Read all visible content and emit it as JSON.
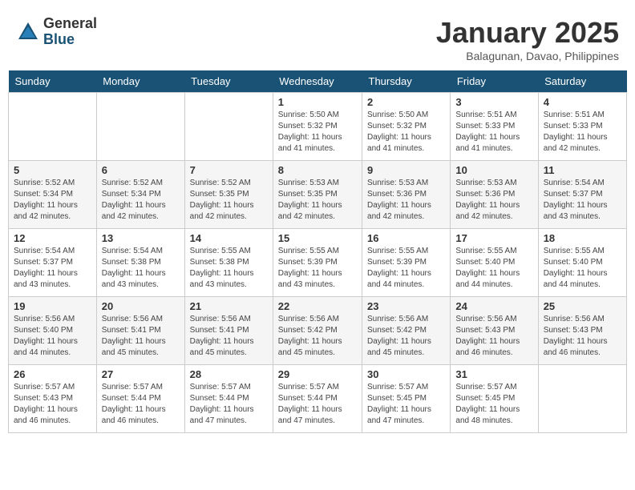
{
  "logo": {
    "general": "General",
    "blue": "Blue"
  },
  "header": {
    "title": "January 2025",
    "subtitle": "Balagunan, Davao, Philippines"
  },
  "weekdays": [
    "Sunday",
    "Monday",
    "Tuesday",
    "Wednesday",
    "Thursday",
    "Friday",
    "Saturday"
  ],
  "weeks": [
    [
      {
        "day": "",
        "info": ""
      },
      {
        "day": "",
        "info": ""
      },
      {
        "day": "",
        "info": ""
      },
      {
        "day": "1",
        "info": "Sunrise: 5:50 AM\nSunset: 5:32 PM\nDaylight: 11 hours and 41 minutes."
      },
      {
        "day": "2",
        "info": "Sunrise: 5:50 AM\nSunset: 5:32 PM\nDaylight: 11 hours and 41 minutes."
      },
      {
        "day": "3",
        "info": "Sunrise: 5:51 AM\nSunset: 5:33 PM\nDaylight: 11 hours and 41 minutes."
      },
      {
        "day": "4",
        "info": "Sunrise: 5:51 AM\nSunset: 5:33 PM\nDaylight: 11 hours and 42 minutes."
      }
    ],
    [
      {
        "day": "5",
        "info": "Sunrise: 5:52 AM\nSunset: 5:34 PM\nDaylight: 11 hours and 42 minutes."
      },
      {
        "day": "6",
        "info": "Sunrise: 5:52 AM\nSunset: 5:34 PM\nDaylight: 11 hours and 42 minutes."
      },
      {
        "day": "7",
        "info": "Sunrise: 5:52 AM\nSunset: 5:35 PM\nDaylight: 11 hours and 42 minutes."
      },
      {
        "day": "8",
        "info": "Sunrise: 5:53 AM\nSunset: 5:35 PM\nDaylight: 11 hours and 42 minutes."
      },
      {
        "day": "9",
        "info": "Sunrise: 5:53 AM\nSunset: 5:36 PM\nDaylight: 11 hours and 42 minutes."
      },
      {
        "day": "10",
        "info": "Sunrise: 5:53 AM\nSunset: 5:36 PM\nDaylight: 11 hours and 42 minutes."
      },
      {
        "day": "11",
        "info": "Sunrise: 5:54 AM\nSunset: 5:37 PM\nDaylight: 11 hours and 43 minutes."
      }
    ],
    [
      {
        "day": "12",
        "info": "Sunrise: 5:54 AM\nSunset: 5:37 PM\nDaylight: 11 hours and 43 minutes."
      },
      {
        "day": "13",
        "info": "Sunrise: 5:54 AM\nSunset: 5:38 PM\nDaylight: 11 hours and 43 minutes."
      },
      {
        "day": "14",
        "info": "Sunrise: 5:55 AM\nSunset: 5:38 PM\nDaylight: 11 hours and 43 minutes."
      },
      {
        "day": "15",
        "info": "Sunrise: 5:55 AM\nSunset: 5:39 PM\nDaylight: 11 hours and 43 minutes."
      },
      {
        "day": "16",
        "info": "Sunrise: 5:55 AM\nSunset: 5:39 PM\nDaylight: 11 hours and 44 minutes."
      },
      {
        "day": "17",
        "info": "Sunrise: 5:55 AM\nSunset: 5:40 PM\nDaylight: 11 hours and 44 minutes."
      },
      {
        "day": "18",
        "info": "Sunrise: 5:55 AM\nSunset: 5:40 PM\nDaylight: 11 hours and 44 minutes."
      }
    ],
    [
      {
        "day": "19",
        "info": "Sunrise: 5:56 AM\nSunset: 5:40 PM\nDaylight: 11 hours and 44 minutes."
      },
      {
        "day": "20",
        "info": "Sunrise: 5:56 AM\nSunset: 5:41 PM\nDaylight: 11 hours and 45 minutes."
      },
      {
        "day": "21",
        "info": "Sunrise: 5:56 AM\nSunset: 5:41 PM\nDaylight: 11 hours and 45 minutes."
      },
      {
        "day": "22",
        "info": "Sunrise: 5:56 AM\nSunset: 5:42 PM\nDaylight: 11 hours and 45 minutes."
      },
      {
        "day": "23",
        "info": "Sunrise: 5:56 AM\nSunset: 5:42 PM\nDaylight: 11 hours and 45 minutes."
      },
      {
        "day": "24",
        "info": "Sunrise: 5:56 AM\nSunset: 5:43 PM\nDaylight: 11 hours and 46 minutes."
      },
      {
        "day": "25",
        "info": "Sunrise: 5:56 AM\nSunset: 5:43 PM\nDaylight: 11 hours and 46 minutes."
      }
    ],
    [
      {
        "day": "26",
        "info": "Sunrise: 5:57 AM\nSunset: 5:43 PM\nDaylight: 11 hours and 46 minutes."
      },
      {
        "day": "27",
        "info": "Sunrise: 5:57 AM\nSunset: 5:44 PM\nDaylight: 11 hours and 46 minutes."
      },
      {
        "day": "28",
        "info": "Sunrise: 5:57 AM\nSunset: 5:44 PM\nDaylight: 11 hours and 47 minutes."
      },
      {
        "day": "29",
        "info": "Sunrise: 5:57 AM\nSunset: 5:44 PM\nDaylight: 11 hours and 47 minutes."
      },
      {
        "day": "30",
        "info": "Sunrise: 5:57 AM\nSunset: 5:45 PM\nDaylight: 11 hours and 47 minutes."
      },
      {
        "day": "31",
        "info": "Sunrise: 5:57 AM\nSunset: 5:45 PM\nDaylight: 11 hours and 48 minutes."
      },
      {
        "day": "",
        "info": ""
      }
    ]
  ]
}
